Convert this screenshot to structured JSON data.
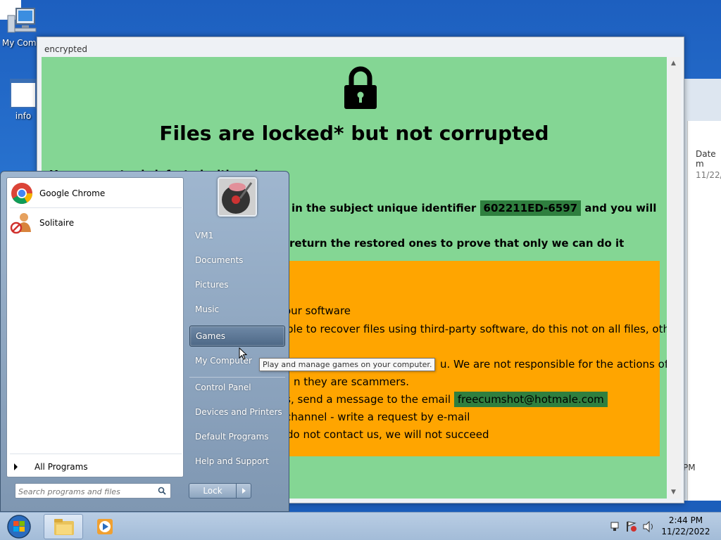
{
  "desktop": {
    "icons": [
      {
        "label": "My Comp",
        "name": "my-computer"
      },
      {
        "label": "info",
        "name": "info"
      }
    ]
  },
  "background_window": {
    "column_header": "Date m",
    "cell": "11/22/",
    "time_fragment": "PM"
  },
  "ransom_window": {
    "title": "encrypted",
    "heading": "Files are locked* but not corrupted",
    "line_infected": "Your computer is infected with a virus",
    "line_identifier_prefix": "y in the subject unique identifier",
    "identifier": "602211ED-6597",
    "line_identifier_suffix": "and you will",
    "line_restore": "return the restored ones to prove that only we can do it",
    "orange": {
      "line1": "our software",
      "line2": "ble to recover files using third-party software, do this not on all files, otherwise",
      "line3": "u. We are not responsible for the actions of third",
      "line4": "n they are scammers.",
      "line5_prefix": "rs, send a message to the email",
      "email": "freecumshot@hotmale.com",
      "line6": "channel - write a request by e-mail",
      "line7": "do not contact us, we will not succeed"
    },
    "colors": {
      "content_bg": "#84d694",
      "highlight": "#2f7f3f",
      "orange": "#ffa500"
    }
  },
  "start_menu": {
    "pinned": [
      {
        "label": "Google Chrome",
        "icon": "chrome-icon"
      },
      {
        "label": "Solitaire",
        "icon": "solitaire-icon"
      }
    ],
    "all_programs": "All Programs",
    "search_placeholder": "Search programs and files",
    "right_items": [
      {
        "label": "VM1"
      },
      {
        "label": "Documents"
      },
      {
        "label": "Pictures"
      },
      {
        "label": "Music"
      },
      {
        "label": "Games",
        "active": true
      },
      {
        "label": "My Computer"
      },
      {
        "label": "Control Panel"
      },
      {
        "label": "Devices and Printers"
      },
      {
        "label": "Default Programs"
      },
      {
        "label": "Help and Support"
      }
    ],
    "lock_label": "Lock",
    "tooltip": "Play and manage games on your computer."
  },
  "taskbar": {
    "time": "2:44 PM",
    "date": "11/22/2022"
  }
}
